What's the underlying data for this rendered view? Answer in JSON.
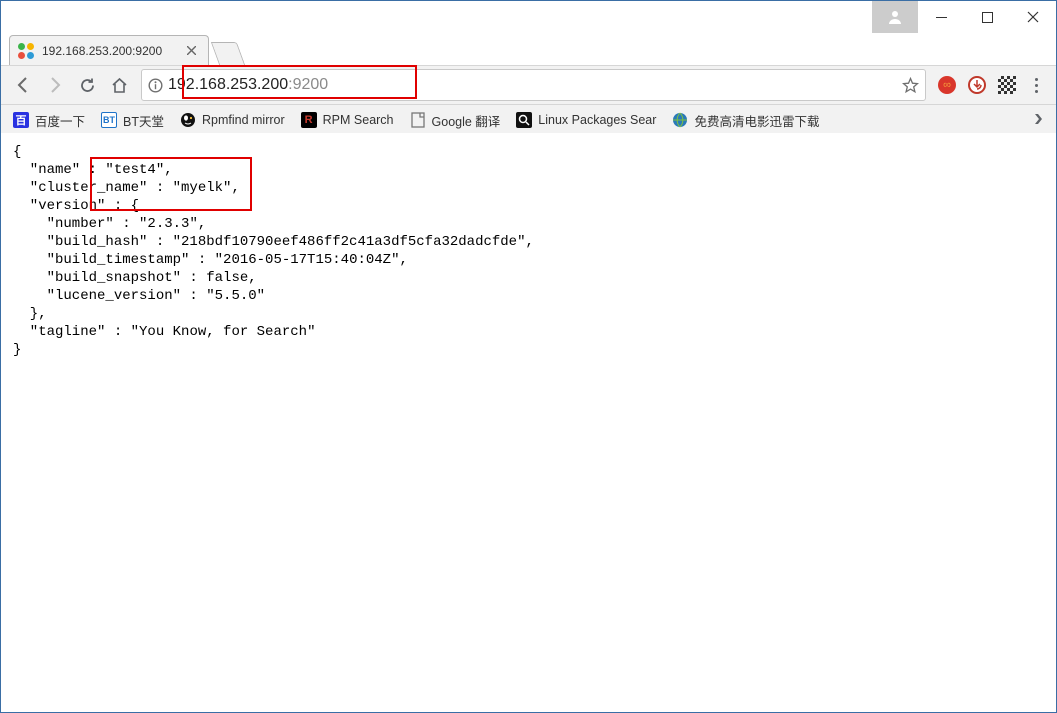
{
  "window": {
    "tab_title": "192.168.253.200:9200",
    "url_host": "192.168.253.200",
    "url_port": ":9200"
  },
  "bookmarks": [
    {
      "label": "百度一下"
    },
    {
      "label": "BT天堂"
    },
    {
      "label": "Rpmfind mirror"
    },
    {
      "label": "RPM Search"
    },
    {
      "label": "Google 翻译"
    },
    {
      "label": "Linux Packages Sear"
    },
    {
      "label": "免费高清电影迅雷下载"
    }
  ],
  "response": {
    "name": "test4",
    "cluster_name": "myelk",
    "version": {
      "number": "2.3.3",
      "build_hash": "218bdf10790eef486ff2c41a3df5cfa32dadcfde",
      "build_timestamp": "2016-05-17T15:40:04Z",
      "build_snapshot": "false",
      "lucene_version": "5.5.0"
    },
    "tagline": "You Know, for Search"
  }
}
